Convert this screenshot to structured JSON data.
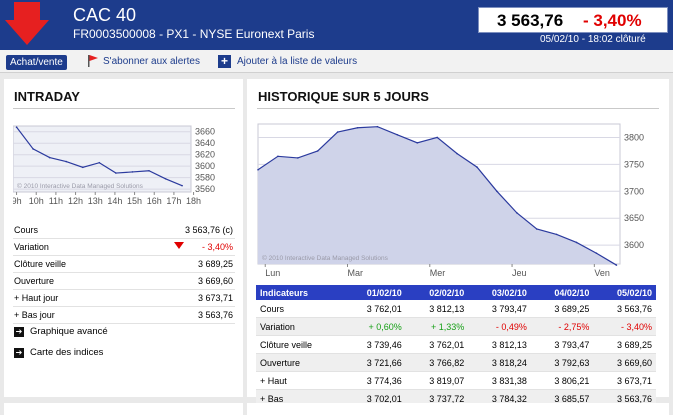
{
  "header": {
    "title": "CAC 40",
    "subtitle": "FR0003500008 - PX1 - NYSE Euronext Paris",
    "price": "3 563,76",
    "change_pct": "- 3,40%",
    "datetime": "05/02/10 - 18:02 clôturé"
  },
  "toolbar": {
    "achat_label": "Achat/vente",
    "alertes_label": "S'abonner aux alertes",
    "ajouter_label": "Ajouter à la liste de valeurs"
  },
  "intraday": {
    "title": "INTRADAY",
    "copyright": "© 2010 Interactive Data Managed Solutions",
    "stats": [
      {
        "label": "Cours",
        "value": "3 563,76 (c)"
      },
      {
        "label": "Variation",
        "value": "- 3,40%"
      },
      {
        "label": "Clôture veille",
        "value": "3 689,25"
      },
      {
        "label": "Ouverture",
        "value": "3 669,60"
      },
      {
        "label": "+ Haut jour",
        "value": "3 673,71"
      },
      {
        "label": "+ Bas jour",
        "value": "3 563,76"
      }
    ],
    "links": [
      "Graphique avancé",
      "Carte des indices"
    ]
  },
  "historique": {
    "title": "HISTORIQUE SUR 5 JOURS",
    "copyright": "© 2010 Interactive Data Managed Solutions",
    "table": {
      "headers": [
        "Indicateurs",
        "01/02/10",
        "02/02/10",
        "03/02/10",
        "04/02/10",
        "05/02/10"
      ],
      "rows": [
        [
          "Cours",
          "3 762,01",
          "3 812,13",
          "3 793,47",
          "3 689,25",
          "3 563,76"
        ],
        [
          "Variation",
          "+ 0,60%",
          "+ 1,33%",
          "- 0,49%",
          "- 2,75%",
          "- 3,40%"
        ],
        [
          "Clôture veille",
          "3 739,46",
          "3 762,01",
          "3 812,13",
          "3 793,47",
          "3 689,25"
        ],
        [
          "Ouverture",
          "3 721,66",
          "3 766,82",
          "3 818,24",
          "3 792,63",
          "3 669,60"
        ],
        [
          "+ Haut",
          "3 774,36",
          "3 819,07",
          "3 831,38",
          "3 806,21",
          "3 673,71"
        ],
        [
          "+ Bas",
          "3 702,01",
          "3 737,72",
          "3 784,32",
          "3 685,57",
          "3 563,76"
        ]
      ]
    }
  },
  "colors": {
    "header_bg": "#1d3c8c",
    "table_header_bg": "#2a3fc2",
    "negative": "#e00000",
    "positive": "#17a017",
    "line": "#2b3a9e"
  },
  "chart_data": [
    {
      "type": "line",
      "title": "INTRADAY",
      "x": [
        "9h",
        "10h",
        "11h",
        "12h",
        "13h",
        "14h",
        "15h",
        "16h",
        "17h",
        "18h"
      ],
      "series": [
        {
          "values": [
            3668,
            3630,
            3615,
            3608,
            3598,
            3606,
            3588,
            3590,
            3592,
            3578,
            3566
          ]
        }
      ],
      "yticks": [
        3660,
        3640,
        3620,
        3600,
        3580,
        3560
      ],
      "ylim": [
        3555,
        3670
      ]
    },
    {
      "type": "area",
      "title": "HISTORIQUE SUR 5 JOURS",
      "x": [
        "Lun",
        "Mar",
        "Mer",
        "Jeu",
        "Ven"
      ],
      "series": [
        {
          "values": [
            3740,
            3765,
            3762,
            3775,
            3810,
            3818,
            3820,
            3805,
            3790,
            3800,
            3770,
            3745,
            3700,
            3660,
            3630,
            3620,
            3605,
            3585,
            3563
          ]
        }
      ],
      "yticks": [
        3800,
        3750,
        3700,
        3650,
        3600
      ],
      "ylim": [
        3565,
        3825
      ]
    }
  ]
}
